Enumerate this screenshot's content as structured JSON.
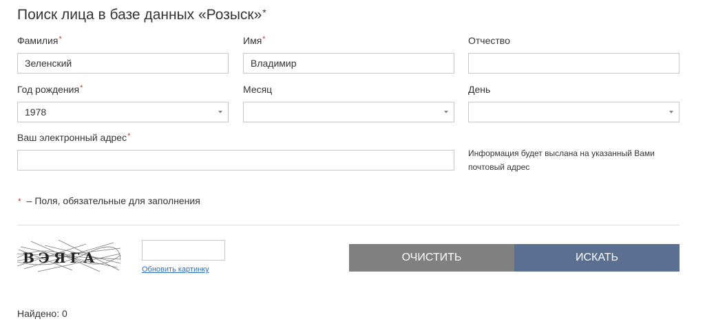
{
  "page": {
    "title": "Поиск лица в базе данных «Розыск»",
    "title_asterisk": "*"
  },
  "form": {
    "surname": {
      "label": "Фамилия",
      "required": "*",
      "value": "Зеленский"
    },
    "name": {
      "label": "Имя",
      "required": "*",
      "value": "Владимир"
    },
    "patronymic": {
      "label": "Отчество",
      "value": ""
    },
    "birth_year": {
      "label": "Год рождения",
      "required": "*",
      "value": "1978"
    },
    "month": {
      "label": "Месяц",
      "value": ""
    },
    "day": {
      "label": "День",
      "value": ""
    },
    "email": {
      "label": "Ваш электронный адрес",
      "required": "*",
      "value": ""
    },
    "email_hint": "Информация будет выслана на указанный Вами почтовый адрес"
  },
  "legend": {
    "star": "*",
    "text": "– Поля, обязательные для заполнения"
  },
  "captcha": {
    "image_text": "ВЭЯГА",
    "input_value": "",
    "refresh_label": "Обновить картинку"
  },
  "buttons": {
    "clear": "очистить",
    "search": "искать"
  },
  "results": {
    "found_text": "Найдено: 0"
  },
  "colors": {
    "required": "#c0392b",
    "clear_button": "#808080",
    "search_button": "#5b6f92",
    "link": "#2a6fb5"
  }
}
